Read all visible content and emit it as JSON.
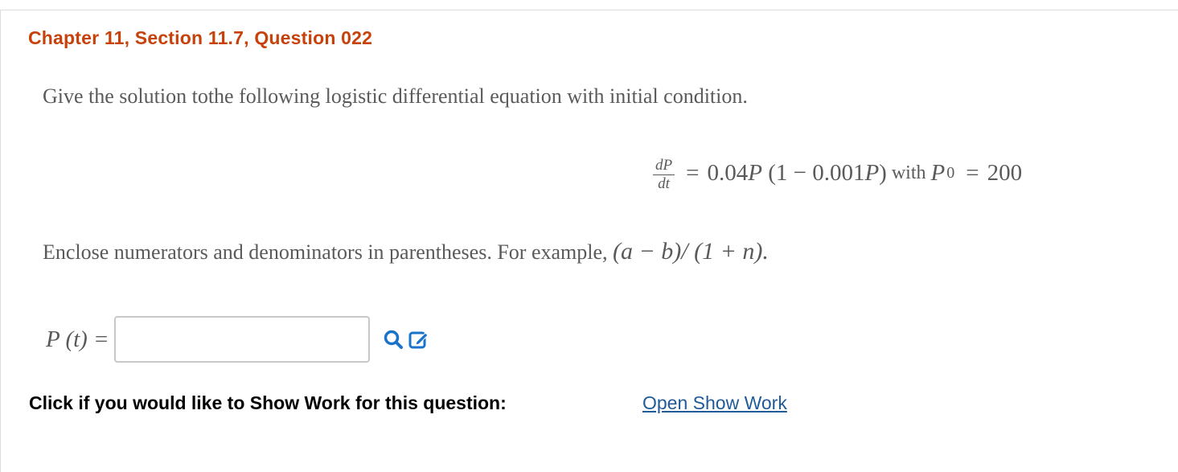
{
  "question": {
    "title": "Chapter 11, Section 11.7, Question 022",
    "prompt": "Give the solution tothe following logistic differential equation with initial condition."
  },
  "equation": {
    "numerator": "dP",
    "denominator": "dt",
    "equals": "=",
    "rhs_coef": "0.04",
    "rhs_var": "P",
    "rhs_paren_open": "(1 − 0.001",
    "rhs_paren_var": "P",
    "rhs_paren_close": ")",
    "with_text": "with",
    "initial_var": "P",
    "initial_sub": "0",
    "initial_equals": "=",
    "initial_value": "200"
  },
  "instruction": {
    "text": "Enclose numerators and denominators in parentheses. For example, ",
    "example": "(a − b)/ (1 + n)."
  },
  "answer": {
    "label": "P (t) =",
    "value": "",
    "placeholder": ""
  },
  "icons": {
    "search": "search-icon",
    "edit": "edit-icon"
  },
  "colors": {
    "title": "#c7410a",
    "link": "#1f5a99",
    "icon": "#1a73c9"
  },
  "show_work": {
    "label": "Click if you would like to Show Work for this question:",
    "link": "Open Show Work"
  }
}
